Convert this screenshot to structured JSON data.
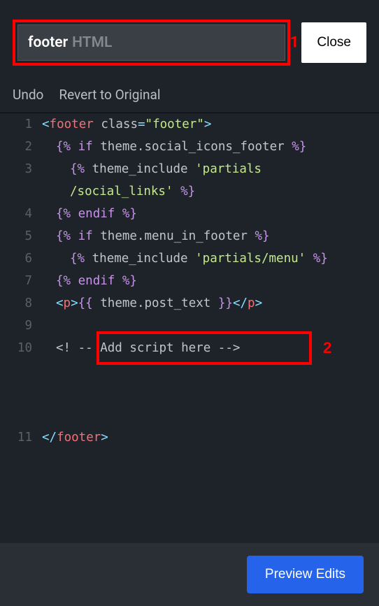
{
  "header": {
    "search_value": "footer",
    "search_hint": "HTML",
    "close_label": "Close",
    "annotation_1": "1"
  },
  "actions": {
    "undo": "Undo",
    "revert": "Revert to Original"
  },
  "code": {
    "lines": [
      {
        "num": "1"
      },
      {
        "num": "2"
      },
      {
        "num": "3"
      },
      {
        "num": "4"
      },
      {
        "num": "5"
      },
      {
        "num": "6"
      },
      {
        "num": "7"
      },
      {
        "num": "8"
      },
      {
        "num": "9"
      },
      {
        "num": "10"
      },
      {
        "num": "11"
      }
    ],
    "l1_tag": "footer",
    "l1_attr": "class",
    "l1_val": "\"footer\"",
    "l2_if": "if",
    "l2_expr": "theme.social_icons_footer",
    "l3_inc": "theme_include",
    "l3_str1": "'partials",
    "l3_str2": "/social_links'",
    "l4_endif": "endif",
    "l5_if": "if",
    "l5_expr": "theme.menu_in_footer",
    "l6_inc": "theme_include",
    "l6_str": "'partials/menu'",
    "l7_endif": "endif",
    "l8_tag": "p",
    "l8_expr": "theme.post_text",
    "l10_comment": "<! -- Add script here -->",
    "l11_tag": "footer",
    "annotation_2": "2"
  },
  "footer": {
    "preview_label": "Preview Edits"
  }
}
